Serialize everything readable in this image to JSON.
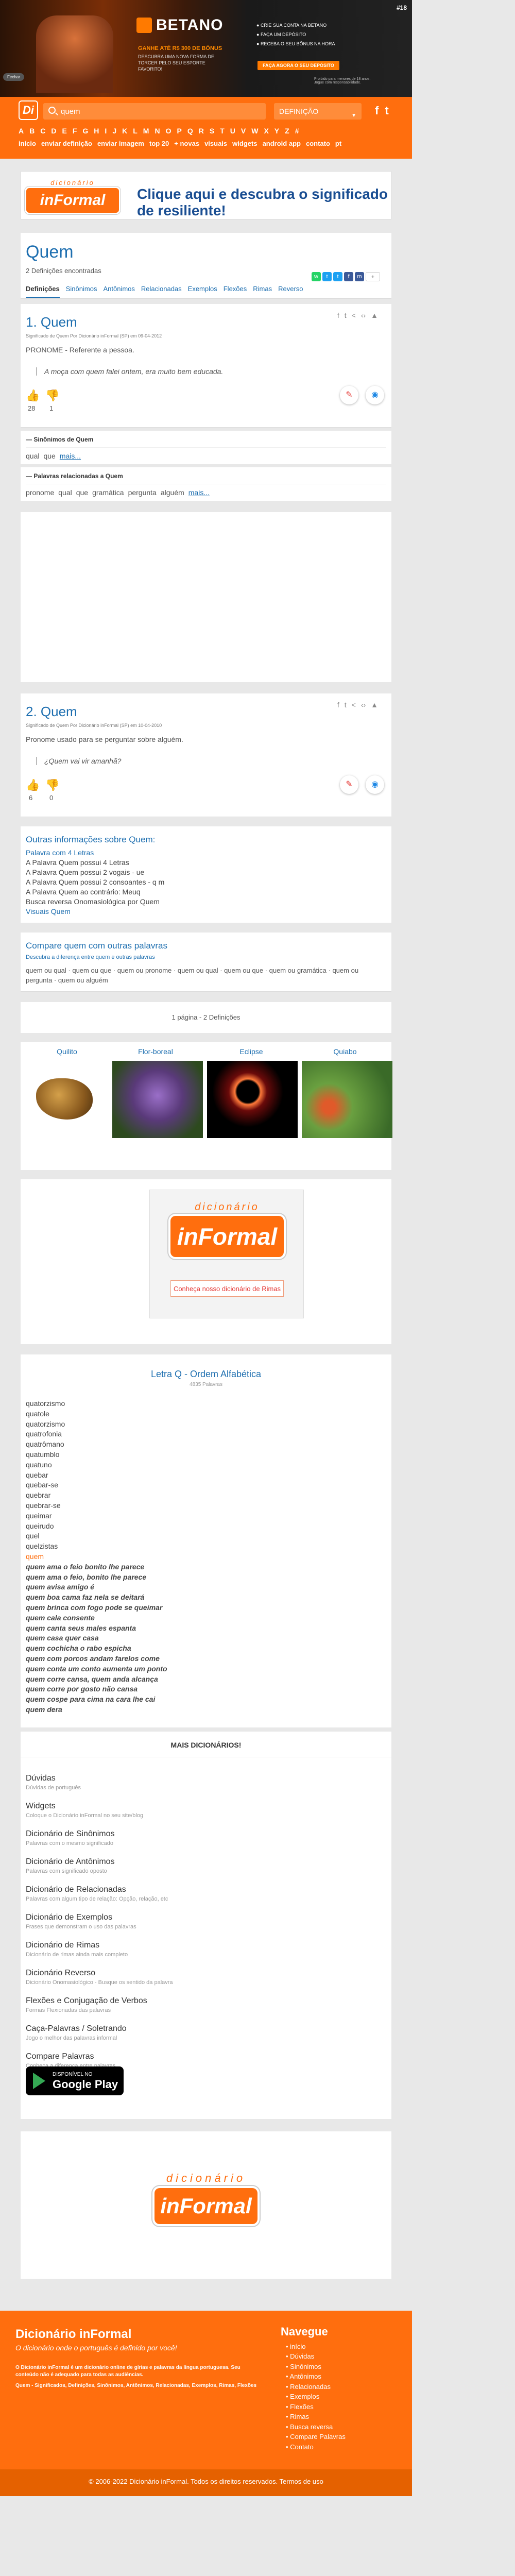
{
  "ad_top": {
    "brand": "BETANO",
    "tagline": "GANHE ATÉ R$ 300 DE BÔNUS",
    "subtext": "DESCUBRA UMA NOVA FORMA DE TORCER PELO SEU ESPORTE FAVORITO!",
    "steps": [
      "CRIE SUA CONTA NA BETANO",
      "FAÇA UM DEPÓSITO",
      "RECEBA O SEU BÔNUS NA HORA"
    ],
    "cta": "FAÇA AGORA O SEU DEPÓSITO",
    "age": "#18",
    "legal": "Proibido para menores de 18 anos. Jogue com responsabilidade.",
    "close": "Fechar"
  },
  "header": {
    "logo": "Di",
    "search_value": "quem",
    "select_value": "DEFINIÇÃO",
    "social": [
      "f",
      "t"
    ],
    "letters": [
      "A",
      "B",
      "C",
      "D",
      "E",
      "F",
      "G",
      "H",
      "I",
      "J",
      "K",
      "L",
      "M",
      "N",
      "O",
      "P",
      "Q",
      "R",
      "S",
      "T",
      "U",
      "V",
      "W",
      "X",
      "Y",
      "Z",
      "#"
    ],
    "nav": [
      "início",
      "enviar definição",
      "enviar imagem",
      "top 20",
      "+ novas",
      "visuais",
      "widgets",
      "android app",
      "contato",
      "pt"
    ]
  },
  "banner": {
    "logo_top": "dicionário",
    "logo_main": "inFormal",
    "text": "Clique aqui e descubra o significado de resiliente!"
  },
  "word": {
    "title": "Quem",
    "count": "2 Definições encontradas",
    "plus": "+"
  },
  "tabs": [
    "Definições",
    "Sinônimos",
    "Antônimos",
    "Relacionadas",
    "Exemplos",
    "Flexões",
    "Rimas",
    "Reverso"
  ],
  "defs": [
    {
      "title": "1. Quem",
      "meta": "Significado de Quem Por Dicionário inFormal (SP) em 09-04-2012",
      "body": "PRONOME - Referente a pessoa.",
      "quote": "A moça com quem falei ontem, era muito bem educada.",
      "up": "28",
      "down": "1"
    },
    {
      "title": "2. Quem",
      "meta": "Significado de Quem Por Dicionário inFormal (SP) em 10-04-2010",
      "body": "Pronome usado para se perguntar sobre alguém.",
      "quote": "¿Quem vai vir amanhã?",
      "up": "6",
      "down": "0"
    }
  ],
  "synonyms": {
    "heading": "Sinônimos de Quem",
    "items": [
      "qual",
      "que"
    ],
    "more": "mais..."
  },
  "related": {
    "heading": "Palavras relacionadas a Quem",
    "items": [
      "pronome",
      "qual",
      "que",
      "gramática",
      "pergunta",
      "alguém"
    ],
    "more": "mais..."
  },
  "info": {
    "heading": "Outras informações sobre Quem:",
    "lines": [
      "Palavra com 4 Letras",
      "A Palavra Quem possui 4 Letras",
      "A Palavra Quem possui 2 vogais - ue",
      "A Palavra Quem possui 2 consoantes - q m",
      "A Palavra Quem ao contrário: Meuq",
      "Busca reversa Onomasiológica por Quem",
      "Visuais Quem"
    ]
  },
  "compare": {
    "heading": "Compare quem com outras palavras",
    "sub": "Descubra a diferença entre quem e outras palavras",
    "text": "quem ou qual · quem ou que · quem ou pronome · quem ou qual · quem ou que · quem ou gramática · quem ou pergunta · quem ou alguém"
  },
  "paging": "1 página - 2 Definições",
  "images": [
    "Quilito",
    "Flor-boreal",
    "Eclipse",
    "Quiabo"
  ],
  "ad2": {
    "top": "dicionário",
    "main": "inFormal",
    "cta": "Conheça nosso dicionário de Rimas"
  },
  "alpha": {
    "heading": "Letra Q - Ordem Alfabética",
    "sub": "4835 Palavras",
    "items": [
      {
        "t": "quatorzismo",
        "s": ""
      },
      {
        "t": "quatole",
        "s": ""
      },
      {
        "t": "quatorzismo",
        "s": ""
      },
      {
        "t": "quatrofonia",
        "s": ""
      },
      {
        "t": "quatrômano",
        "s": ""
      },
      {
        "t": "quatumblo",
        "s": ""
      },
      {
        "t": "quatuno",
        "s": ""
      },
      {
        "t": "quebar",
        "s": ""
      },
      {
        "t": "quebar-se",
        "s": ""
      },
      {
        "t": "quebrar",
        "s": ""
      },
      {
        "t": "quebrar-se",
        "s": ""
      },
      {
        "t": "queimar",
        "s": ""
      },
      {
        "t": "queirudo",
        "s": ""
      },
      {
        "t": "quel",
        "s": ""
      },
      {
        "t": "quelzistas",
        "s": ""
      },
      {
        "t": "quem",
        "s": "cur"
      },
      {
        "t": "quem ama o feio bonito lhe parece",
        "s": "bi"
      },
      {
        "t": "quem ama o feio, bonito lhe parece",
        "s": "bi"
      },
      {
        "t": "quem avisa amigo é",
        "s": "bi"
      },
      {
        "t": "quem boa cama faz nela se deitará",
        "s": "bi"
      },
      {
        "t": "quem brinca com fogo pode se queimar",
        "s": "bi"
      },
      {
        "t": "quem cala consente",
        "s": "bi"
      },
      {
        "t": "quem canta seus males espanta",
        "s": "bi"
      },
      {
        "t": "quem casa quer casa",
        "s": "bi"
      },
      {
        "t": "quem cochicha o rabo espicha",
        "s": "bi"
      },
      {
        "t": "quem com porcos andam farelos come",
        "s": "bi"
      },
      {
        "t": "quem conta um conto aumenta um ponto",
        "s": "bi"
      },
      {
        "t": "quem corre cansa, quem anda alcança",
        "s": "bi"
      },
      {
        "t": "quem corre por gosto não cansa",
        "s": "bi"
      },
      {
        "t": "quem cospe para cima na cara lhe cai",
        "s": "bi"
      },
      {
        "t": "quem dera",
        "s": "bi"
      }
    ]
  },
  "more": {
    "heading": "MAIS DICIONÁRIOS!",
    "items": [
      {
        "n": "Dúvidas",
        "d": "Dúvidas de português"
      },
      {
        "n": "Widgets",
        "d": "Coloque o Dicionário inFormal no seu site/blog"
      },
      {
        "n": "Dicionário de Sinônimos",
        "d": "Palavras com o mesmo significado"
      },
      {
        "n": "Dicionário de Antônimos",
        "d": "Palavras com significado oposto"
      },
      {
        "n": "Dicionário de Relacionadas",
        "d": "Palavras com algum tipo de relação: Opção, relação, etc"
      },
      {
        "n": "Dicionário de Exemplos",
        "d": "Frases que demonstram o uso das palavras"
      },
      {
        "n": "Dicionário de Rimas",
        "d": "Dicionário de rimas ainda mais completo"
      },
      {
        "n": "Dicionário Reverso",
        "d": "Dicionário Onomasiológico - Busque os sentido da palavra"
      },
      {
        "n": "Flexões e Conjugação de Verbos",
        "d": "Formas Flexionadas das palavras"
      },
      {
        "n": "Caça-Palavras / Soletrando",
        "d": "Jogo o melhor das palavras informal"
      },
      {
        "n": "Compare Palavras",
        "d": "Conheça a diferença entre palavras"
      }
    ],
    "gplay_small": "DISPONÍVEL NO",
    "gplay_big": "Google Play"
  },
  "footer_logo": {
    "top": "dicionário",
    "main": "inFormal"
  },
  "footer": {
    "title": "Dicionário inFormal",
    "slogan": "O dicionário onde o português é definido por você!",
    "desc": "O Dicionário inFormal é um dicionário online de gírias e palavras da língua portuguesa. Seu conteúdo não é adequado para todas as audiências.",
    "keys": "Quem - Significados, Definições, Sinônimos, Antônimos, Relacionadas, Exemplos, Rimas, Flexões",
    "nav_heading": "Navegue",
    "nav": [
      "início",
      "Dúvidas",
      "Sinônimos",
      "Antônimos",
      "Relacionadas",
      "Exemplos",
      "Flexões",
      "Rimas",
      "Busca reversa",
      "Compare Palavras",
      "Contato"
    ],
    "copyright": "© 2006-2022 Dicionário inFormal. Todos os direitos reservados. Termos de uso"
  },
  "colors": {
    "orange": "#ff6e0e",
    "blue": "#1e6fb0"
  }
}
